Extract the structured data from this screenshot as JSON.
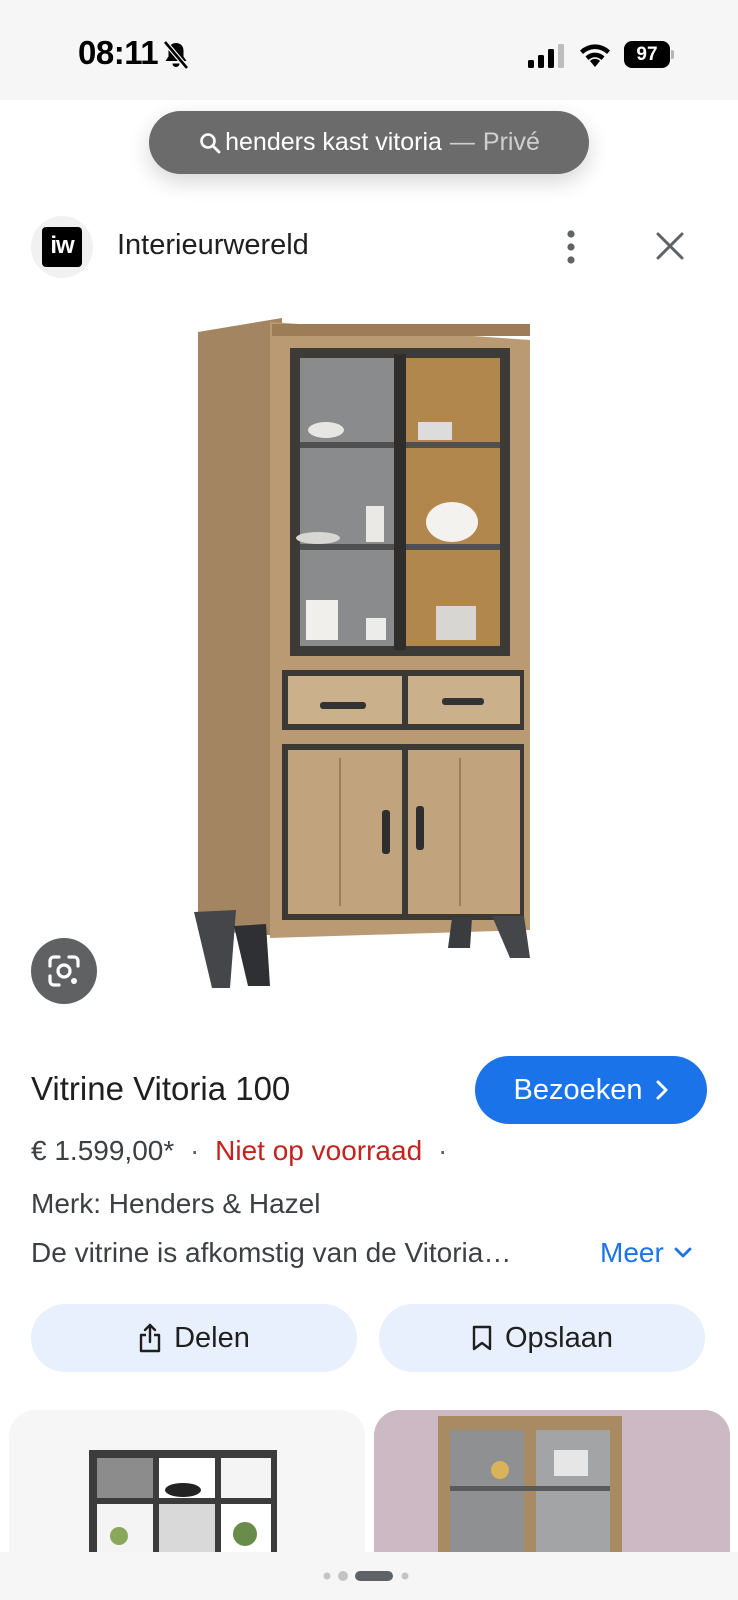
{
  "status_bar": {
    "time": "08:11",
    "battery": "97",
    "icons": [
      "bell-slash-icon",
      "signal-icon",
      "wifi-icon",
      "battery-icon"
    ]
  },
  "search": {
    "query": "henders kast vitoria",
    "separator": "—",
    "mode": "Privé"
  },
  "source": {
    "logo_text": "iw",
    "name": "Interieurwereld"
  },
  "product": {
    "title": "Vitrine Vitoria 100",
    "visit_label": "Bezoeken",
    "price": "€ 1.599,00*",
    "separator": "·",
    "stock_status": "Niet op voorraad",
    "brand": "Merk: Henders & Hazel",
    "description": "De vitrine is afkomstig van de Vitoria…",
    "more_label": "Meer"
  },
  "actions": {
    "share_label": "Delen",
    "save_label": "Opslaan"
  },
  "colors": {
    "accent": "#1a73e8",
    "out_of_stock": "#c5221f",
    "action_bg": "#e8f0fe"
  },
  "pagination": {
    "active_index": 2,
    "count": 4
  }
}
